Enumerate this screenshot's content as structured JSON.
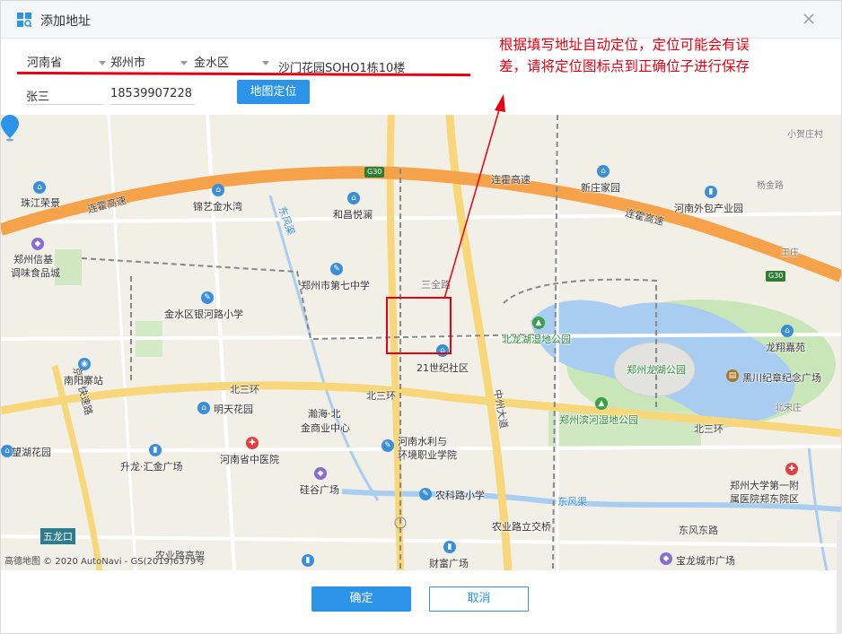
{
  "dialog": {
    "title": "添加地址",
    "close_icon": "close-icon"
  },
  "form": {
    "province": "河南省",
    "city": "郑州市",
    "district": "金水区",
    "address": "沙门花园SOHO1栋10楼",
    "name": "张三",
    "phone": "18539907228",
    "locate_button": "地图定位"
  },
  "annotation": {
    "text": "根据填写地址自动定位，定位可能会有误差，请将定位图标点到正确位子进行保存"
  },
  "map": {
    "pois": [
      "珠江荣景",
      "锦艺金水湾",
      "和昌悦澜",
      "新庄家园",
      "杨金路",
      "小贺庄村",
      "郑州信基",
      "调味食品城",
      "河南外包产业园",
      "王庄",
      "郑州市第七中学",
      "三全路",
      "金水区银河路小学",
      "北龙湖湿地公园",
      "龙翔嘉苑",
      "21世纪社区",
      "南阳寨站",
      "郑州龙湖公园",
      "黑川纪章纪念广场",
      "北三环",
      "北三环",
      "明天花园",
      "瀚海·北",
      "金商业中心",
      "中州大道",
      "郑州滨河湿地公园",
      "北三环",
      "北宋庄",
      "望湖花园",
      "升龙·汇金广场",
      "河南省中医院",
      "河南水利与",
      "环境职业学院",
      "硅谷广场",
      "郑州大学第一附",
      "属医院郑东院区",
      "农科路小学",
      "东风渠",
      "五龙口",
      "农业路立交桥",
      "东风东路",
      "农业路高架",
      "财富广场",
      "宝龙城市广场"
    ],
    "roads": [
      "连霍高速",
      "连霍高速",
      "连霍高速",
      "东风渠",
      "京广快速路"
    ],
    "shields": [
      "G30",
      "G30"
    ],
    "attribution": "高德地图 © 2020 AutoNavi - GS(2019)6379号"
  },
  "footer": {
    "confirm": "确定",
    "cancel": "取消"
  },
  "colors": {
    "primary": "#2b93e8",
    "annotation": "#e60012",
    "highway": "#f6a24a",
    "road": "#f8d77b",
    "water": "#a8cdf0",
    "park": "#c8e6b7"
  }
}
